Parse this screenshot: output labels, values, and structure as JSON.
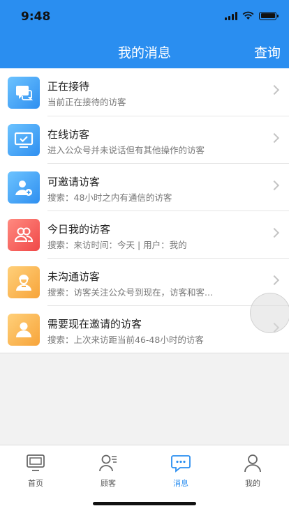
{
  "status": {
    "time": "9:48"
  },
  "header": {
    "title": "我的消息",
    "action": "查询"
  },
  "items": [
    {
      "title": "正在接待",
      "subtitle": "当前正在接待的访客",
      "icon": "chat-bubble-icon",
      "color": "blue"
    },
    {
      "title": "在线访客",
      "subtitle": "进入公众号并未说话但有其他操作的访客",
      "icon": "monitor-check-icon",
      "color": "blue"
    },
    {
      "title": "可邀请访客",
      "subtitle": "搜索：48小时之内有通信的访客",
      "icon": "user-add-icon",
      "color": "blue"
    },
    {
      "title": "今日我的访客",
      "subtitle": "搜索：来访时间：今天 | 用户：我的",
      "icon": "users-icon",
      "color": "red"
    },
    {
      "title": "未沟通访客",
      "subtitle": "搜索：访客关注公众号到现在，访客和客...",
      "icon": "person-badge-icon",
      "color": "orange"
    },
    {
      "title": "需要现在邀请的访客",
      "subtitle": "搜索：上次来访距当前46-48小时的访客",
      "icon": "person-card-icon",
      "color": "orange"
    }
  ],
  "tabs": [
    {
      "label": "首页",
      "icon": "monitor-icon",
      "active": false
    },
    {
      "label": "顾客",
      "icon": "customer-icon",
      "active": false
    },
    {
      "label": "消息",
      "icon": "message-icon",
      "active": true
    },
    {
      "label": "我的",
      "icon": "profile-icon",
      "active": false
    }
  ],
  "colors": {
    "primary": "#2a8ef0",
    "blue_icon": "#3a9bf2",
    "red_icon": "#f25a52",
    "orange_icon": "#f8ad45"
  }
}
